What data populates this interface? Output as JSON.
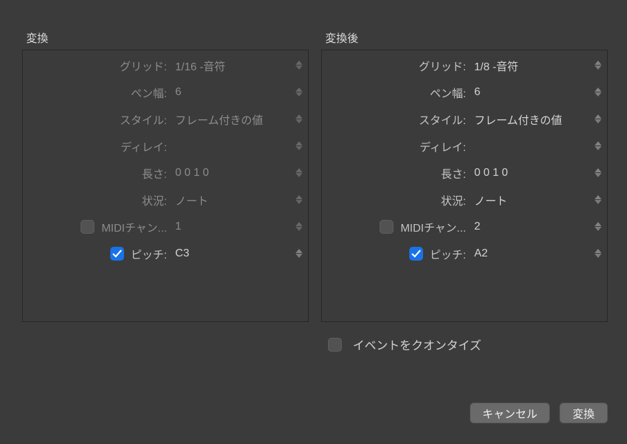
{
  "left": {
    "title": "変換",
    "rows": [
      {
        "label": "グリッド:",
        "value": "1/16 -音符",
        "checkbox": null,
        "dim": true
      },
      {
        "label": "ペン幅:",
        "value": "6",
        "checkbox": null,
        "dim": true
      },
      {
        "label": "スタイル:",
        "value": "フレーム付きの値",
        "checkbox": null,
        "dim": true
      },
      {
        "label": "ディレイ:",
        "value": "",
        "checkbox": null,
        "dim": true
      },
      {
        "label": "長さ:",
        "value": "0 0 1   0",
        "checkbox": null,
        "dim": true,
        "segmented": true
      },
      {
        "label": "状況:",
        "value": "ノート",
        "checkbox": null,
        "dim": true
      },
      {
        "label": "MIDIチャン...",
        "value": "1",
        "checkbox": "off",
        "dim": true
      },
      {
        "label": "ピッチ:",
        "value": "C3",
        "checkbox": "on",
        "dim": false
      }
    ]
  },
  "right": {
    "title": "変換後",
    "rows": [
      {
        "label": "グリッド:",
        "value": "1/8 -音符",
        "checkbox": null,
        "dim": false
      },
      {
        "label": "ペン幅:",
        "value": "6",
        "checkbox": null,
        "dim": false
      },
      {
        "label": "スタイル:",
        "value": "フレーム付きの値",
        "checkbox": null,
        "dim": false
      },
      {
        "label": "ディレイ:",
        "value": "",
        "checkbox": null,
        "dim": false
      },
      {
        "label": "長さ:",
        "value": "0 0 1   0",
        "checkbox": null,
        "dim": false,
        "segmented": true
      },
      {
        "label": "状況:",
        "value": "ノート",
        "checkbox": null,
        "dim": false
      },
      {
        "label": "MIDIチャン...",
        "value": "2",
        "checkbox": "off",
        "dim": false
      },
      {
        "label": "ピッチ:",
        "value": "A2",
        "checkbox": "on",
        "dim": false
      }
    ]
  },
  "quantize": {
    "label": "イベントをクオンタイズ",
    "checked": false
  },
  "buttons": {
    "cancel": "キャンセル",
    "ok": "変換"
  }
}
